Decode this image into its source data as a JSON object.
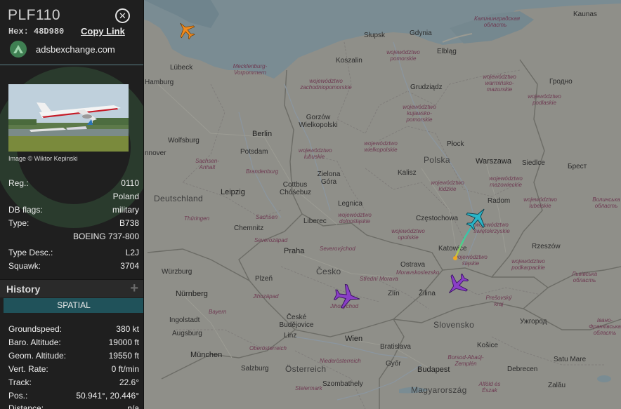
{
  "aircraft": {
    "callsign": "PLF110",
    "hex_label": "Hex:",
    "hex": "48D980",
    "copy_link": "Copy Link",
    "adsb_site": "adsbexchange.com",
    "photo_credit": "Image © Wiktor Kepinski"
  },
  "details": [
    {
      "key": "Reg.:",
      "value": "0110"
    },
    {
      "key": "",
      "value": "Poland"
    },
    {
      "key": "DB flags:",
      "value": "military"
    },
    {
      "key": "Type:",
      "value": "B738"
    },
    {
      "key": "",
      "value": "BOEING 737-800"
    },
    {
      "key": "Type Desc.:",
      "value": "L2J"
    },
    {
      "key": "Squawk:",
      "value": "3704"
    }
  ],
  "history": {
    "title": "History",
    "tab": "SPATIAL"
  },
  "spatial": [
    {
      "key": "Groundspeed:",
      "value": "380 kt"
    },
    {
      "key": "Baro. Altitude:",
      "value": "19000 ft"
    },
    {
      "key": "Geom. Altitude:",
      "value": "19550 ft"
    },
    {
      "key": "Vert. Rate:",
      "value": "0 ft/min"
    },
    {
      "key": "Track:",
      "value": "22.6°"
    },
    {
      "key": "Pos.:",
      "value": "50.941°, 20.446°"
    },
    {
      "key": "Distance:",
      "value": "n/a"
    }
  ],
  "map": {
    "cities": [
      "Hamburg",
      "Lübeck",
      "Słupsk",
      "Gdynia",
      "Elbląg",
      "Kaunas",
      "Koszalin",
      "Grudziądz",
      "Гродно",
      "Gorzów Wielkopolski",
      "Berlin",
      "Potsdam",
      "Wolfsburg",
      "nnover",
      "Płock",
      "Warszawa",
      "Siedlce",
      "Брест",
      "Zielona Góra",
      "Kalisz",
      "Polska",
      "Leipzig",
      "Cottbus Chóśebuz",
      "Radom",
      "Deutschland",
      "Legnica",
      "Liberec",
      "Częstochowa",
      "Chemnitz",
      "Praha",
      "Katowice",
      "Ostrava",
      "Česko",
      "Würzburg",
      "Plzeň",
      "Zlín",
      "Žilina",
      "Kraków",
      "Nürnberg",
      "Ingolstadt",
      "Augsburg",
      "České Budějovice",
      "Linz",
      "Wien",
      "Bratislava",
      "Slovensko",
      "Košice",
      "Ужгород",
      "München",
      "Salzburg",
      "Österreich",
      "Győr",
      "Budapest",
      "Szombathely",
      "Magyarország",
      "Debrecen",
      "Satu Mare",
      "Zalău",
      "Rzeszów"
    ],
    "countries": [
      "Polska",
      "Deutschland",
      "Česko",
      "Slovensko",
      "Österreich",
      "Magyarország"
    ],
    "regions": [
      "Калининградская область",
      "województwo pomorskie",
      "województwo zachodniopomorskie",
      "województwo warmińsko-mazurskie",
      "Mecklenburg-Vorpommern",
      "województwo kujawsko-pomorskie",
      "województwo podlaskie",
      "województwo lubuskie",
      "województwo wielkopolskie",
      "województwo mazowieckie",
      "województwo łódzkie",
      "Sachsen-Anhalt",
      "Brandenburg",
      "Sachsen",
      "województwo dolnośląskie",
      "województwo opolskie",
      "województwo świętokrzyskie",
      "województwo lubelskie",
      "Волинська область",
      "Thüringen",
      "Severozápad",
      "Severovýchod",
      "województwo śląskie",
      "województwo małopolskie",
      "województwo podkarpackie",
      "Львівська область",
      "Jihozápad",
      "Střední Morava",
      "Moravskoslezsko",
      "Bayern",
      "Jihovýchod",
      "Prešovský kraj",
      "Oberösterreich",
      "Niederösterreich",
      "Steiermark",
      "Borsod-Abaúj-Zemplén",
      "Alföld és Észak",
      "Івано-Франківська область"
    ]
  },
  "colors": {
    "panel_bg": "#1f1f1f",
    "accent_teal": "#20525a",
    "selected_aircraft": "#2ab5c8",
    "other_aircraft": "#8a3fc6",
    "orange_aircraft": "#f08a1e"
  }
}
